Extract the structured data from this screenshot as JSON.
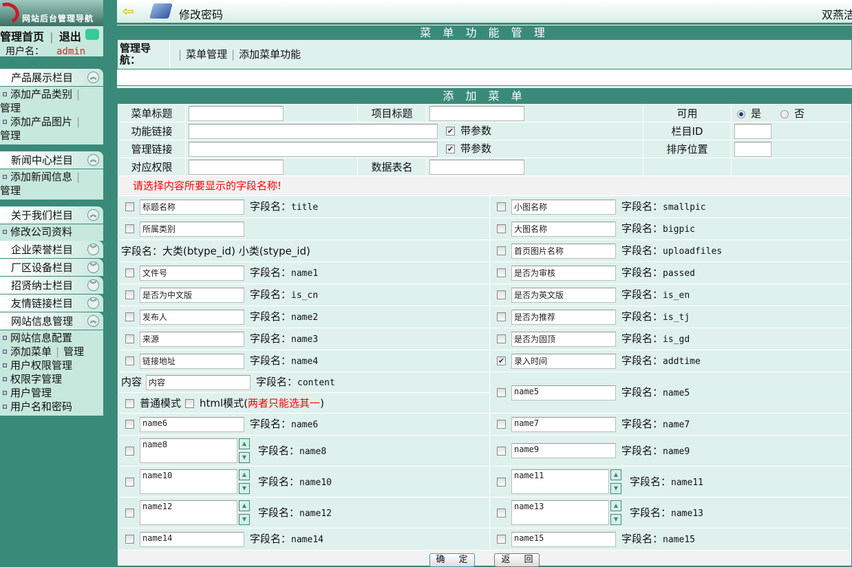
{
  "sidebar": {
    "logo": "网站后台管理导航",
    "home": "管理首页",
    "logout": "退出",
    "user_label": "用户名：",
    "user": "admin",
    "groups": [
      {
        "title": "产品展示栏目",
        "open": true,
        "items": [
          {
            "label": "添加产品类别",
            "extra": "管理"
          },
          {
            "label": "添加产品图片",
            "extra": "管理"
          }
        ]
      },
      {
        "title": "新闻中心栏目",
        "open": true,
        "items": [
          {
            "label": "添加新闻信息",
            "extra": "管理"
          }
        ]
      },
      {
        "title": "关于我们栏目",
        "open": true,
        "items": [
          {
            "label": "修改公司资料"
          }
        ]
      },
      {
        "title": "企业荣誉栏目",
        "open": false,
        "items": []
      },
      {
        "title": "厂区设备栏目",
        "open": false,
        "items": []
      },
      {
        "title": "招贤纳士栏目",
        "open": false,
        "items": []
      },
      {
        "title": "友情链接栏目",
        "open": false,
        "items": []
      },
      {
        "title": "网站信息管理",
        "open": true,
        "items": [
          {
            "label": "网站信息配置"
          },
          {
            "label": "添加菜单",
            "inline": "管理"
          },
          {
            "label": "用户权限管理"
          },
          {
            "label": "权限字管理"
          },
          {
            "label": "用户管理"
          },
          {
            "label": "用户名和密码"
          }
        ]
      }
    ]
  },
  "topbar": {
    "title": "修改密码",
    "right": "双燕洁具"
  },
  "panel": {
    "title": "菜 单 功 能 管 理",
    "nav_label": "管理导航：",
    "links": [
      "菜单管理",
      "添加菜单功能"
    ]
  },
  "form": {
    "title": "添 加 菜 单",
    "menu_title": "菜单标题",
    "item_title": "项目标题",
    "enabled": "可用",
    "yes": "是",
    "no": "否",
    "func_link": "功能链接",
    "with_param": "带参数",
    "column_id": "栏目ID",
    "admin_link": "管理链接",
    "sort": "排序位置",
    "permission": "对应权限",
    "table_name": "数据表名",
    "hint": "请选择内容所要显示的字段名称!",
    "fn_prefix": "字段名：",
    "category_note": "字段名：大类(btype_id) 小类(stype_id)",
    "content_label": "内容",
    "content_value": "内容",
    "content_field": "content",
    "mode_normal": "普通模式",
    "mode_html": "html模式",
    "mode_note_open": "(",
    "mode_note": "两者只能选其一",
    "mode_note_close": ")",
    "ok": "确 定",
    "back": "返 回"
  },
  "fields_left": [
    {
      "value": "标题名称",
      "field": "title"
    },
    {
      "value": "所属类别",
      "field": ""
    },
    {
      "note": true
    },
    {
      "value": "文件号",
      "field": "name1"
    },
    {
      "value": "是否为中文版",
      "field": "is_cn"
    },
    {
      "value": "发布人",
      "field": "name2"
    },
    {
      "value": "来源",
      "field": "name3"
    },
    {
      "value": "链接地址",
      "field": "name4"
    },
    {
      "content": true
    },
    {
      "mode": true
    },
    {
      "value": "name6",
      "field": "name6"
    },
    {
      "value": "name8",
      "field": "name8",
      "ta": true
    },
    {
      "value": "name10",
      "field": "name10",
      "ta": true
    },
    {
      "value": "name12",
      "field": "name12",
      "ta": true
    },
    {
      "value": "name14",
      "field": "name14"
    }
  ],
  "fields_right": [
    {
      "value": "小图名称",
      "field": "smallpic"
    },
    {
      "value": "大图名称",
      "field": "bigpic"
    },
    {
      "value": "首页图片名称",
      "field": "uploadfiles"
    },
    {
      "value": "是否为审核",
      "field": "passed"
    },
    {
      "value": "是否为英文版",
      "field": "is_en"
    },
    {
      "value": "是否为推荐",
      "field": "is_tj"
    },
    {
      "value": "是否为固顶",
      "field": "is_gd"
    },
    {
      "value": "录入时间",
      "field": "addtime",
      "checked": true
    },
    {
      "value": "name5",
      "field": "name5",
      "span": 2
    },
    {
      "value": "name7",
      "field": "name7"
    },
    {
      "value": "name9",
      "field": "name9"
    },
    {
      "value": "name11",
      "field": "name11",
      "ta": true
    },
    {
      "value": "name13",
      "field": "name13",
      "ta": true
    },
    {
      "value": "name15",
      "field": "name15"
    }
  ]
}
